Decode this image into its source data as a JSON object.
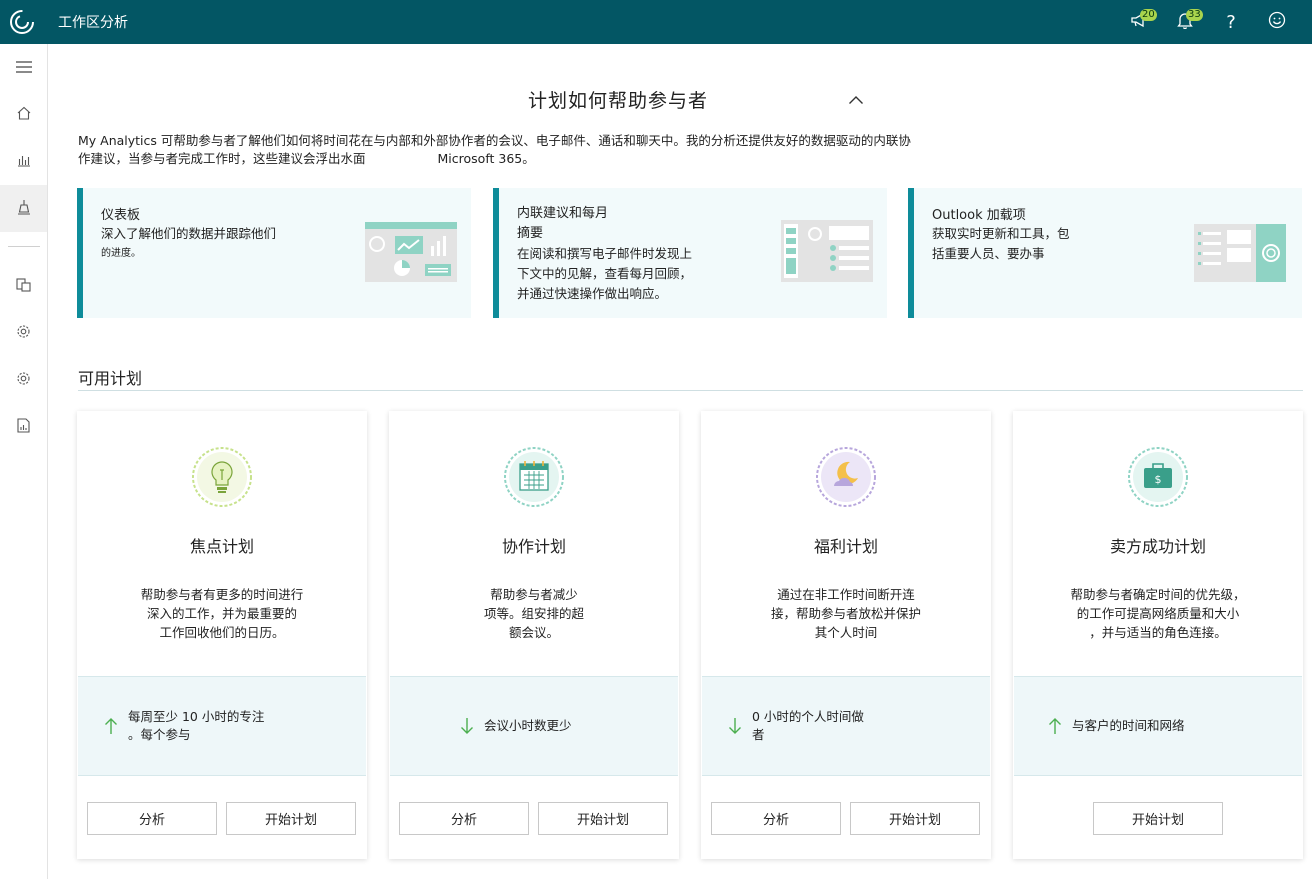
{
  "app": {
    "title": "工作区分析"
  },
  "header": {
    "announcements_count": "20",
    "notifications_count": "33",
    "help": "?"
  },
  "hero": {
    "title": "计划如何帮助参与者",
    "intro_line1": "My Analytics 可帮助参与者了解他们如何将时间花在与内部和外部协作者的会议、电子邮件、通话和聊天中。我的分析还提供友好的数据驱动的内联协",
    "intro_line2": "作建议，当参与者完成工作时，这些建议会浮出水面",
    "intro_line2_suffix": "Microsoft 365。"
  },
  "features": [
    {
      "title": "仪表板",
      "desc1": "深入了解他们的数据并跟踪他们",
      "desc2": "的进度。"
    },
    {
      "title": "内联建议和每月",
      "title2": "摘要",
      "desc1": "在阅读和撰写电子邮件时发现上",
      "desc2": "下文中的见解，查看每月回顾，",
      "desc3": "并通过快速操作做出响应。"
    },
    {
      "title": "Outlook 加载项",
      "desc1": "获取实时更新和工具，包",
      "desc2": "括重要人员、要办事"
    }
  ],
  "section": {
    "title": "可用计划"
  },
  "plans": [
    {
      "name": "焦点计划",
      "desc": [
        "帮助参与者有更多的时间进行",
        "深入的工作，并为最重要的",
        "工作回收他们的日历。"
      ],
      "metric": [
        "每周至少 10 小时的专注",
        "。每个参与"
      ],
      "analyze": "分析",
      "start": "开始计划"
    },
    {
      "name": "协作计划",
      "desc": [
        "帮助参与者减少",
        "项等。组安排的超",
        "额会议。"
      ],
      "metric": [
        "会议小时数更少"
      ],
      "analyze": "分析",
      "start": "开始计划"
    },
    {
      "name": "福利计划",
      "desc": [
        "通过在非工作时间断开连",
        "接，帮助参与者放松并保护",
        "其个人时间"
      ],
      "metric": [
        "0 小时的个人时间做",
        "者"
      ],
      "analyze": "分析",
      "start": "开始计划"
    },
    {
      "name": "卖方成功计划",
      "desc": [
        "帮助参与者确定时间的优先级，",
        "的工作可提高网络质量和大小",
        "，并与适当的角色连接。"
      ],
      "metric": [
        "与客户的时间和网络"
      ],
      "start": "开始计划"
    }
  ]
}
